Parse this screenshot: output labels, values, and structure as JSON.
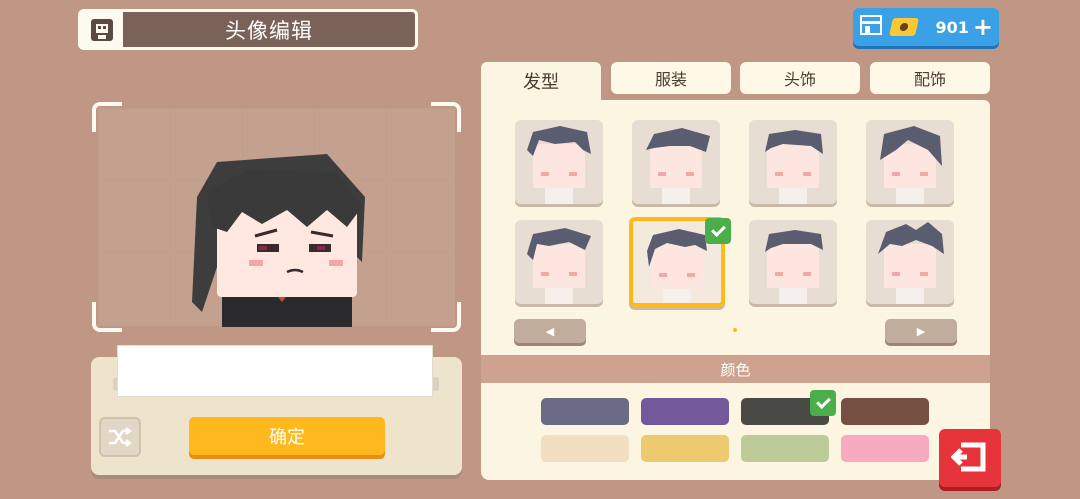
{
  "header": {
    "title": "头像编辑",
    "icon": "avatar-icon"
  },
  "currency": {
    "amount": "901",
    "icon": "coin-icon"
  },
  "tabs": [
    {
      "label": "发型",
      "active": true
    },
    {
      "label": "服装",
      "active": false
    },
    {
      "label": "头饰",
      "active": false
    },
    {
      "label": "配饰",
      "active": false
    }
  ],
  "hair_grid": {
    "count": 8,
    "selected_index": 5,
    "hair_color": "#5a5c70"
  },
  "pager": {
    "prev": "◀",
    "next": "▶"
  },
  "color_section": {
    "label": "颜色"
  },
  "colors": [
    {
      "hex": "#6a6c86",
      "selected": false
    },
    {
      "hex": "#73589a",
      "selected": false
    },
    {
      "hex": "#4a4a44",
      "selected": true
    },
    {
      "hex": "#754f40",
      "selected": false
    },
    {
      "hex": "#f2dfc2",
      "selected": false
    },
    {
      "hex": "#edca70",
      "selected": false
    },
    {
      "hex": "#bccb98",
      "selected": false
    },
    {
      "hex": "#f7aac0",
      "selected": false
    }
  ],
  "name_panel": {
    "value": "",
    "confirm_label": "确定"
  }
}
